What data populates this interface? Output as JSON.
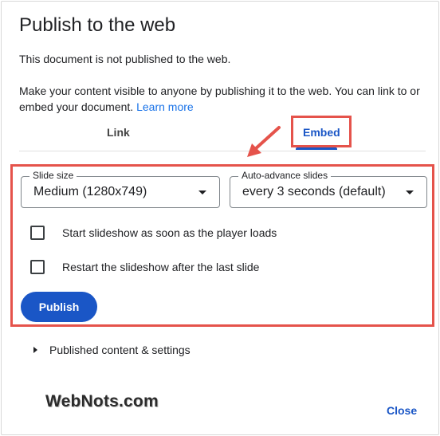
{
  "dialog": {
    "title": "Publish to the web",
    "status": "This document is not published to the web.",
    "description": "Make your content visible to anyone by publishing it to the web. You can link to or embed your document.",
    "learn_more": "Learn more"
  },
  "tabs": [
    {
      "label": "Link",
      "selected": false
    },
    {
      "label": "Embed",
      "selected": true
    }
  ],
  "embed": {
    "slide_size": {
      "label": "Slide size",
      "value": "Medium (1280x749)"
    },
    "auto_advance": {
      "label": "Auto-advance slides",
      "value": "every 3 seconds (default)"
    },
    "options": [
      {
        "label": "Start slideshow as soon as the player loads",
        "checked": false
      },
      {
        "label": "Restart the slideshow after the last slide",
        "checked": false
      }
    ],
    "publish_label": "Publish"
  },
  "settings": {
    "label": "Published content & settings"
  },
  "footer": {
    "close_label": "Close"
  },
  "watermark": "WebNots.com",
  "colors": {
    "accent": "#1a56c6",
    "highlight": "#e5534b"
  }
}
